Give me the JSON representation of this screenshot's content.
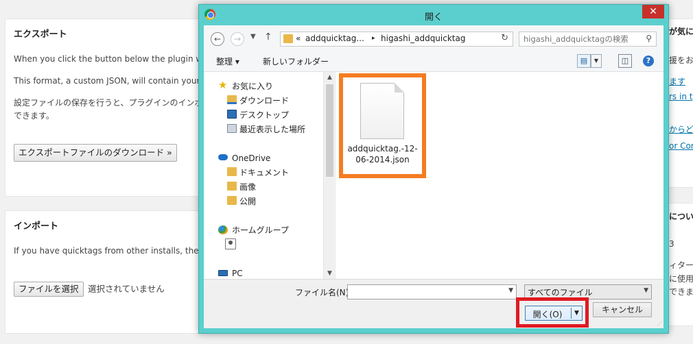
{
  "background": {
    "export": {
      "title": "エクスポート",
      "line1": "When you click the button below the plugin w",
      "line2": "This format, a custom JSON, will contain your",
      "line3": "設定ファイルの保存を行うと、プラグインのインポー",
      "line4": "できます。",
      "button": "エクスポートファイルのダウンロード »"
    },
    "import": {
      "title": "インポート",
      "line1": "If you have quicktags from other installs, the",
      "choose_button": "ファイルを選択",
      "no_file": "選択されていません"
    },
    "right_fragments": {
      "f1": "が気に",
      "f2": "援をお",
      "f3": "ます",
      "f4": "rs in t",
      "f5": "からどれ",
      "f6": "or Con",
      "f7": "につい",
      "f8": "3",
      "f9": "ィター",
      "f10": "に使用",
      "f11": "できます"
    }
  },
  "dialog": {
    "title": "開く",
    "close_label": "✕",
    "breadcrumb": {
      "prefix": "«",
      "parent": "addquicktag...",
      "separator": "▸",
      "current": "higashi_addquicktag"
    },
    "search_placeholder": "higashi_addquicktagの検索",
    "toolbar": {
      "organize": "整理 ▾",
      "new_folder": "新しいフォルダー"
    },
    "nav": {
      "favorites": "お気に入り",
      "downloads": "ダウンロード",
      "desktop": "デスクトップ",
      "recent": "最近表示した場所",
      "onedrive": "OneDrive",
      "documents": "ドキュメント",
      "pictures": "画像",
      "public": "公開",
      "homegroup": "ホームグループ",
      "pc": "PC"
    },
    "file": {
      "name": "addquicktag.-12-06-2014.json"
    },
    "filename_label": "ファイル名(N):",
    "filename_value": "",
    "file_type": "すべてのファイル",
    "open_button": "開く(O)",
    "cancel_button": "キャンセル"
  },
  "colors": {
    "dialog_frame": "#5bcfcd",
    "close_button": "#c7312a",
    "file_highlight": "#f57c22",
    "open_highlight": "#e01a22"
  }
}
